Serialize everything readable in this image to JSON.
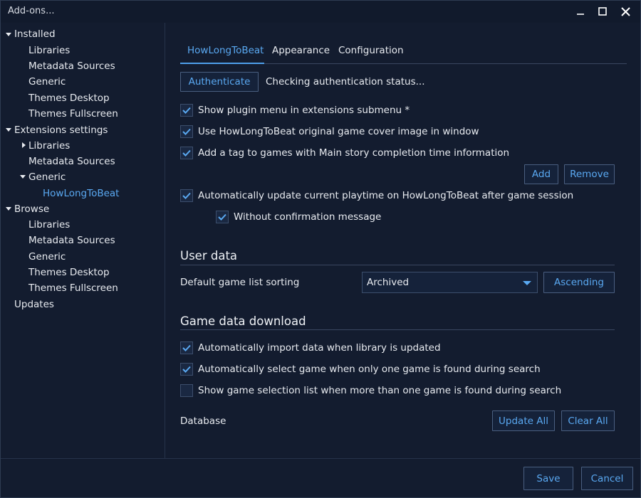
{
  "window": {
    "title": "Add-ons..."
  },
  "sidebar": {
    "installed": "Installed",
    "installed_items": [
      "Libraries",
      "Metadata Sources",
      "Generic",
      "Themes Desktop",
      "Themes Fullscreen"
    ],
    "extensions": "Extensions settings",
    "ext_libraries": "Libraries",
    "ext_metadata": "Metadata Sources",
    "ext_generic": "Generic",
    "ext_hltb": "HowLongToBeat",
    "browse": "Browse",
    "browse_items": [
      "Libraries",
      "Metadata Sources",
      "Generic",
      "Themes Desktop",
      "Themes Fullscreen"
    ],
    "updates": "Updates"
  },
  "tabs": [
    "HowLongToBeat",
    "Appearance",
    "Configuration"
  ],
  "auth": {
    "button": "Authenticate",
    "status": "Checking authentication status..."
  },
  "options": {
    "show_menu": "Show plugin menu in extensions submenu *",
    "use_cover": "Use HowLongToBeat original game cover image in window",
    "add_tag": "Add a tag to games with Main story completion time information",
    "auto_update": "Automatically update current playtime on HowLongToBeat after game session",
    "no_confirm": "Without confirmation message"
  },
  "tag_buttons": {
    "add": "Add",
    "remove": "Remove"
  },
  "user_data": {
    "title": "User data",
    "sorting_label": "Default game list sorting",
    "sorting_value": "Archived",
    "order_button": "Ascending"
  },
  "download": {
    "title": "Game data download",
    "auto_import": "Automatically import data when library is updated",
    "auto_select": "Automatically select game when only one game is found during search",
    "show_list": "Show game selection list when more than one game is found during search",
    "database_label": "Database",
    "update_all": "Update All",
    "clear_all": "Clear All"
  },
  "footer": {
    "save": "Save",
    "cancel": "Cancel"
  },
  "colors": {
    "accent": "#5aa9f2",
    "background": "#131c2f",
    "text": "#e8ebf0"
  }
}
